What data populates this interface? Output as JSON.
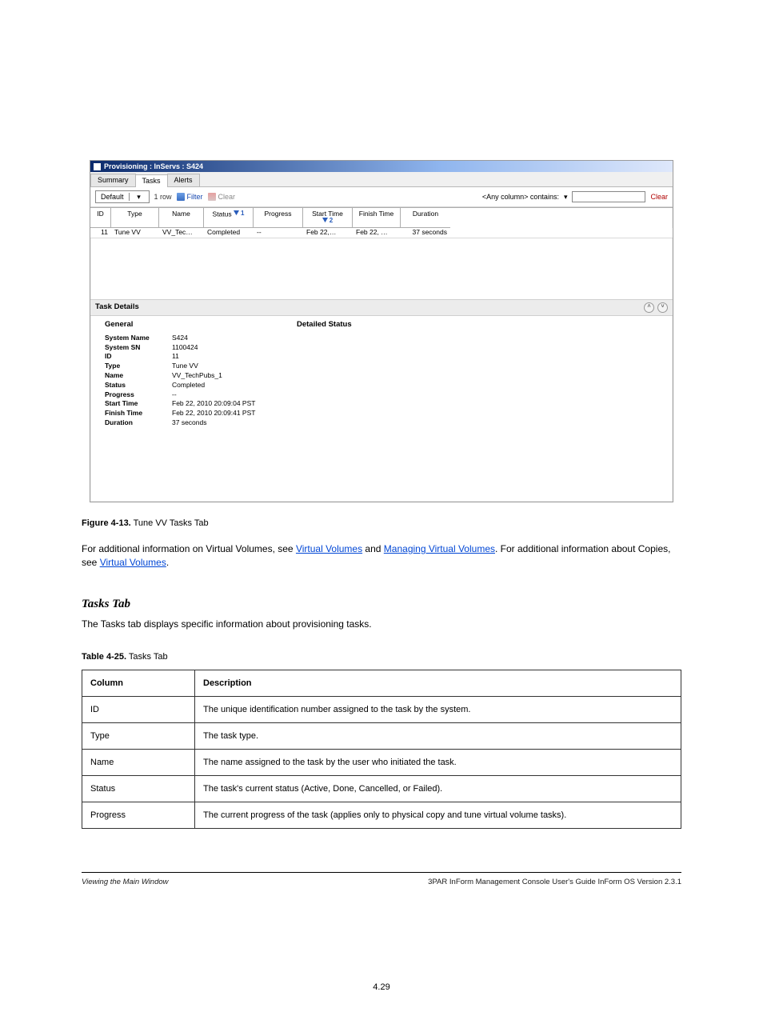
{
  "window": {
    "title": "Provisioning : InServs : S424"
  },
  "tabs": [
    "Summary",
    "Tasks",
    "Alerts"
  ],
  "active_tab": 1,
  "toolbar": {
    "view_combo_selected": "Default",
    "row_count_text": "1 row",
    "filter_label": "Filter",
    "filter_clear_label": "Clear",
    "search_scope_label": "<Any column> contains:",
    "search_clear_label": "Clear"
  },
  "grid": {
    "columns": [
      "ID",
      "Type",
      "Name",
      "Status",
      "Progress",
      "Start Time",
      "Finish Time",
      "Duration"
    ],
    "sort_status": "1",
    "sort_start": "2",
    "rows": [
      {
        "id": "11",
        "type": "Tune VV",
        "name": "VV_Tec…",
        "status": "Completed",
        "progress": "--",
        "start": "Feb 22,…",
        "finish": "Feb 22, …",
        "duration": "37 seconds"
      }
    ]
  },
  "task_details": {
    "section_title": "Task Details",
    "general_title": "General",
    "detailed_title": "Detailed Status",
    "fields": {
      "System Name": "S424",
      "System SN": "1100424",
      "ID": "11",
      "Type": "Tune VV",
      "Name": "VV_TechPubs_1",
      "Status": "Completed",
      "Progress": "--",
      "Start Time": "Feb 22, 2010 20:09:04 PST",
      "Finish Time": "Feb 22, 2010 20:09:41 PST",
      "Duration": "37 seconds"
    }
  },
  "doc": {
    "fig_label": "Figure 4-13.",
    "fig_title": "  Tune VV Tasks Tab",
    "para": {
      "pre": "For additional information on Virtual Volumes, see ",
      "link1": "Virtual Volumes",
      "mid1": " and ",
      "link2": "Managing Virtual Volumes",
      "mid2": ". For additional information about Copies, see ",
      "link3": "Virtual Volumes",
      "post": "."
    },
    "section_heading": "Tasks Tab",
    "para2": "The Tasks tab displays specific information about provisioning tasks.",
    "table_caption_label": "Table 4-25.",
    "table_caption_title": "  Tasks Tab",
    "table": {
      "headers": [
        "Column",
        "Description"
      ],
      "rows": [
        [
          "ID",
          "The unique identification number assigned to the task by the system."
        ],
        [
          "Type",
          "The task type."
        ],
        [
          "Name",
          "The name assigned to the task by the user who initiated the task."
        ],
        [
          "Status",
          "The task's current status (Active, Done, Cancelled, or Failed)."
        ],
        [
          "Progress",
          "The current progress of the task (applies only to physical copy and tune virtual volume tasks)."
        ]
      ]
    },
    "page_number": "4.29",
    "run_left": "Viewing the Main Window",
    "run_right": "3PAR InForm Management Console User's Guide InForm OS Version 2.3.1"
  }
}
